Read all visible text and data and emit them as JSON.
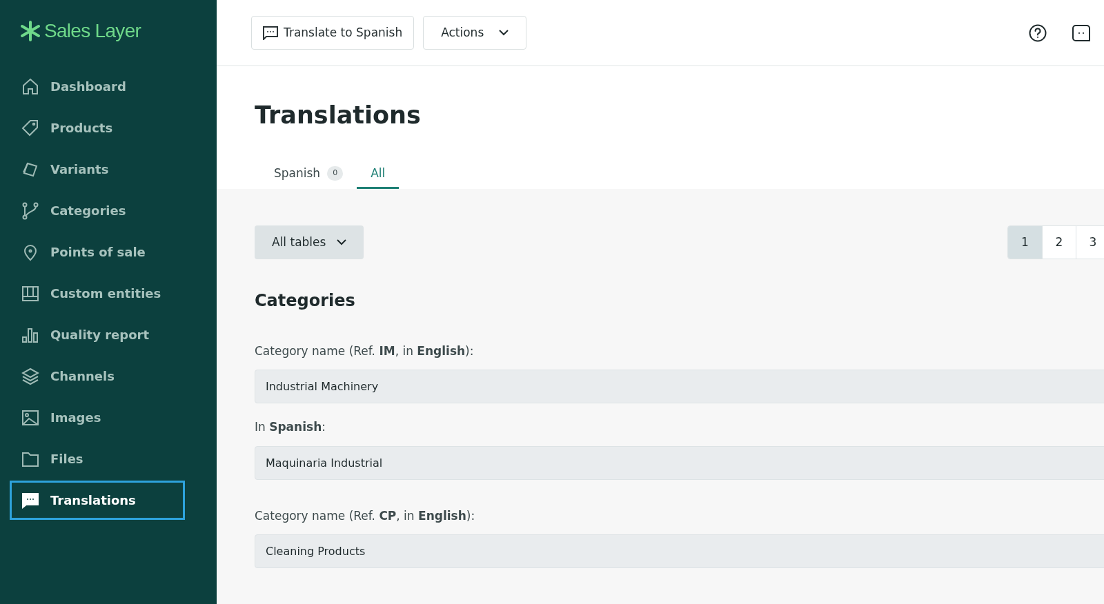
{
  "sidebar": {
    "logo": "Sales Layer",
    "items": [
      {
        "label": "Dashboard",
        "selected": false
      },
      {
        "label": "Products",
        "selected": false
      },
      {
        "label": "Variants",
        "selected": false
      },
      {
        "label": "Categories",
        "selected": false
      },
      {
        "label": "Points of sale",
        "selected": false
      },
      {
        "label": "Custom entities",
        "selected": false
      },
      {
        "label": "Quality report",
        "selected": false
      },
      {
        "label": "Channels",
        "selected": false
      },
      {
        "label": "Images",
        "selected": false
      },
      {
        "label": "Files",
        "selected": false
      },
      {
        "label": "Translations",
        "selected": true
      }
    ]
  },
  "toolbar": {
    "translate_button": "Translate to Spanish",
    "actions_button": "Actions"
  },
  "page": {
    "title": "Translations",
    "tabs": [
      {
        "label": "Spanish",
        "badge": "0",
        "selected": false
      },
      {
        "label": "All",
        "selected": true
      }
    ],
    "filter": "All tables",
    "pagination": [
      {
        "label": "1",
        "selected": true
      },
      {
        "label": "2",
        "selected": false
      },
      {
        "label": "3",
        "selected": false
      }
    ],
    "sections": [
      {
        "heading": "Categories",
        "entries": [
          {
            "source_label": "Category name (Ref. **IM**, in **English**):",
            "source_value": "Industrial Machinery",
            "target_label": "In **Spanish**:",
            "target_value": "Maquinaria Industrial"
          },
          {
            "source_label": "Category name (Ref. **CP**, in **English**):",
            "source_value": "Cleaning Products"
          }
        ]
      }
    ]
  }
}
